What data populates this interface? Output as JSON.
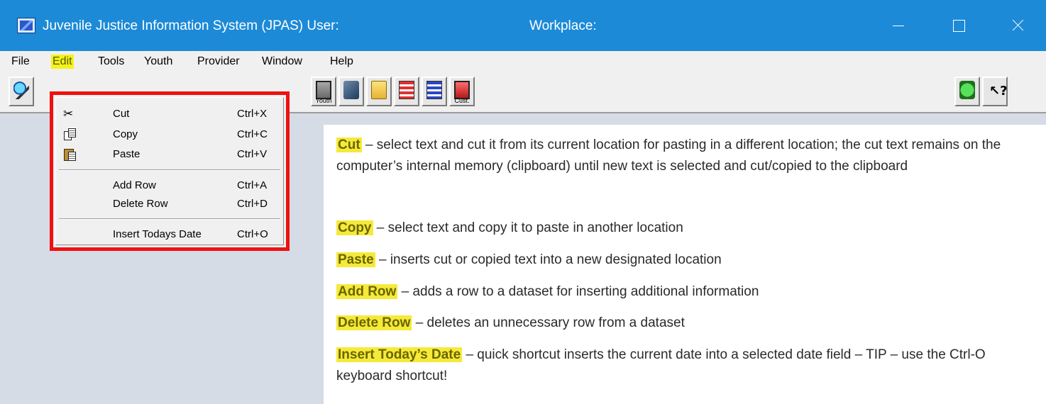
{
  "titlebar": {
    "title": "Juvenile Justice Information System (JPAS)  User:",
    "workplace": "Workplace:"
  },
  "menubar": {
    "items": [
      "File",
      "Edit",
      "Tools",
      "Youth",
      "Provider",
      "Window",
      "Help"
    ],
    "active": "Edit"
  },
  "toolbar": {
    "youth_caption": "Youth",
    "cust_caption": "Cust."
  },
  "edit_menu": {
    "items": [
      {
        "label": "Cut",
        "shortcut": "Ctrl+X",
        "icon": "scissors-icon"
      },
      {
        "label": "Copy",
        "shortcut": "Ctrl+C",
        "icon": "copy-icon"
      },
      {
        "label": "Paste",
        "shortcut": "Ctrl+V",
        "icon": "paste-icon"
      },
      {
        "label": "Add Row",
        "shortcut": "Ctrl+A"
      },
      {
        "label": "Delete Row",
        "shortcut": "Ctrl+D"
      },
      {
        "label": "Insert Todays Date",
        "shortcut": "Ctrl+O"
      }
    ]
  },
  "descriptions": [
    {
      "term": "Cut",
      "text": " – select text and cut it from its current location for pasting in a different location; the cut text remains on the computer’s internal memory (clipboard) until new text is selected and cut/copied to the clipboard"
    },
    {
      "term": "Copy",
      "text": " – select text and copy it to paste in another location"
    },
    {
      "term": "Paste",
      "text": " – inserts cut or copied text into a new designated location"
    },
    {
      "term": "Add Row",
      "text": " – adds a row to a dataset for inserting additional information"
    },
    {
      "term": "Delete Row",
      "text": " – deletes an unnecessary row from a dataset"
    },
    {
      "term": "Insert Today’s Date",
      "text": " – quick shortcut inserts the current date into a selected date field – TIP – use the Ctrl-O keyboard shortcut!"
    }
  ],
  "colors": {
    "titlebar": "#1c8ad7",
    "highlight": "#f5ea3a",
    "menu_border": "#f01010"
  }
}
